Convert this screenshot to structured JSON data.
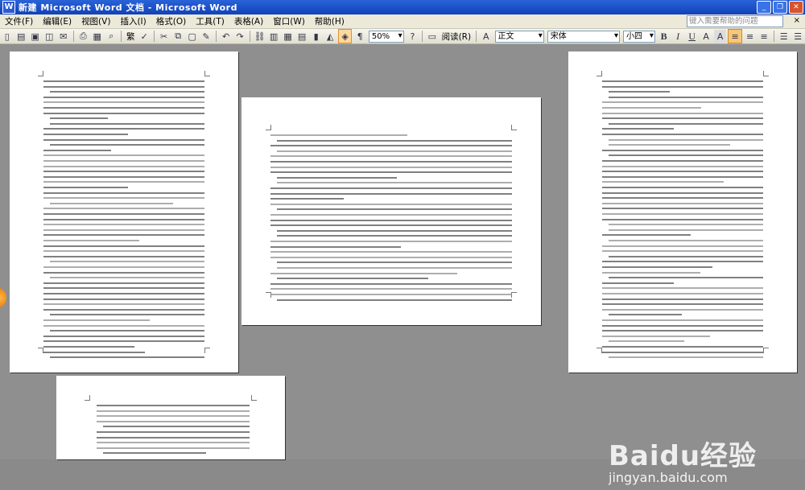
{
  "window": {
    "title": "新建 Microsoft Word 文档 - Microsoft Word",
    "app_icon": "W",
    "minimize_label": "_",
    "restore_label": "❐",
    "close_label": "✕"
  },
  "menu": {
    "items": [
      "文件(F)",
      "编辑(E)",
      "视图(V)",
      "插入(I)",
      "格式(O)",
      "工具(T)",
      "表格(A)",
      "窗口(W)",
      "帮助(H)"
    ],
    "help_search_placeholder": "键入需要帮助的问题",
    "help_close": "×"
  },
  "toolbar": {
    "traditional_label": "繁",
    "zoom_value": "50%",
    "read_label": "阅读(R)",
    "style_value": "正文",
    "font_value": "宋体",
    "size_value": "小四",
    "bold_label": "B",
    "italic_label": "I",
    "underline_label": "U",
    "fontcolor_label": "A",
    "charscale_label": "A"
  },
  "watermark": {
    "logo_text": "Baidu经验",
    "url_text": "jingyan.baidu.com"
  },
  "colors": {
    "titlebar": "#1f55cc",
    "workspace": "#8f8f8f",
    "page": "#ffffff"
  }
}
